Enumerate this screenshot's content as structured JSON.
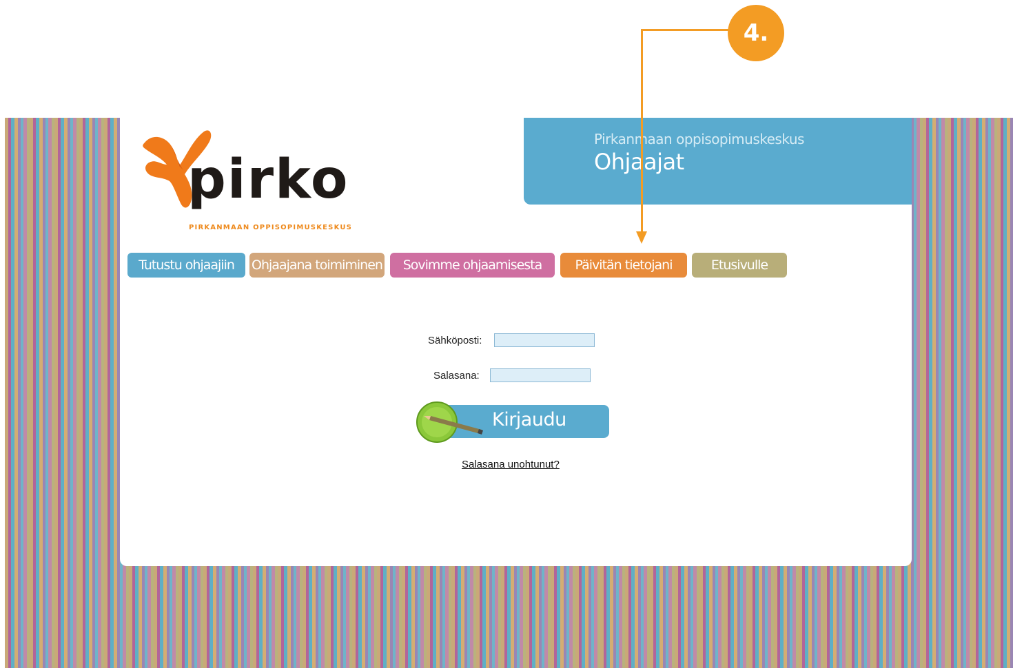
{
  "header": {
    "subtitle": "Pirkanmaan oppisopimuskeskus",
    "title": "Ohjaajat"
  },
  "logo": {
    "wordmark": "pirko",
    "tagline": "PIRKANMAAN OPPISOPIMUSKESKUS"
  },
  "nav": {
    "items": [
      {
        "label": "Tutustu ohjaajiin",
        "color": "#5aa9cc"
      },
      {
        "label": "Ohjaajana toimiminen",
        "color": "#d2a67b"
      },
      {
        "label": "Sovimme ohjaamisesta",
        "color": "#cf6fa1"
      },
      {
        "label": "Päivitän tietojani",
        "color": "#e88b3a"
      },
      {
        "label": "Etusivulle",
        "color": "#b8ae79"
      }
    ]
  },
  "login": {
    "email_label": "Sähköposti:",
    "email_value": "",
    "password_label": "Salasana:",
    "password_value": "",
    "submit_label": "Kirjaudu",
    "forgot_label": "Salasana unohtunut?"
  },
  "callout": {
    "number": "4.",
    "color": "#f39c24"
  },
  "colors": {
    "accent_blue": "#5aabcf",
    "accent_orange": "#f39c24"
  }
}
